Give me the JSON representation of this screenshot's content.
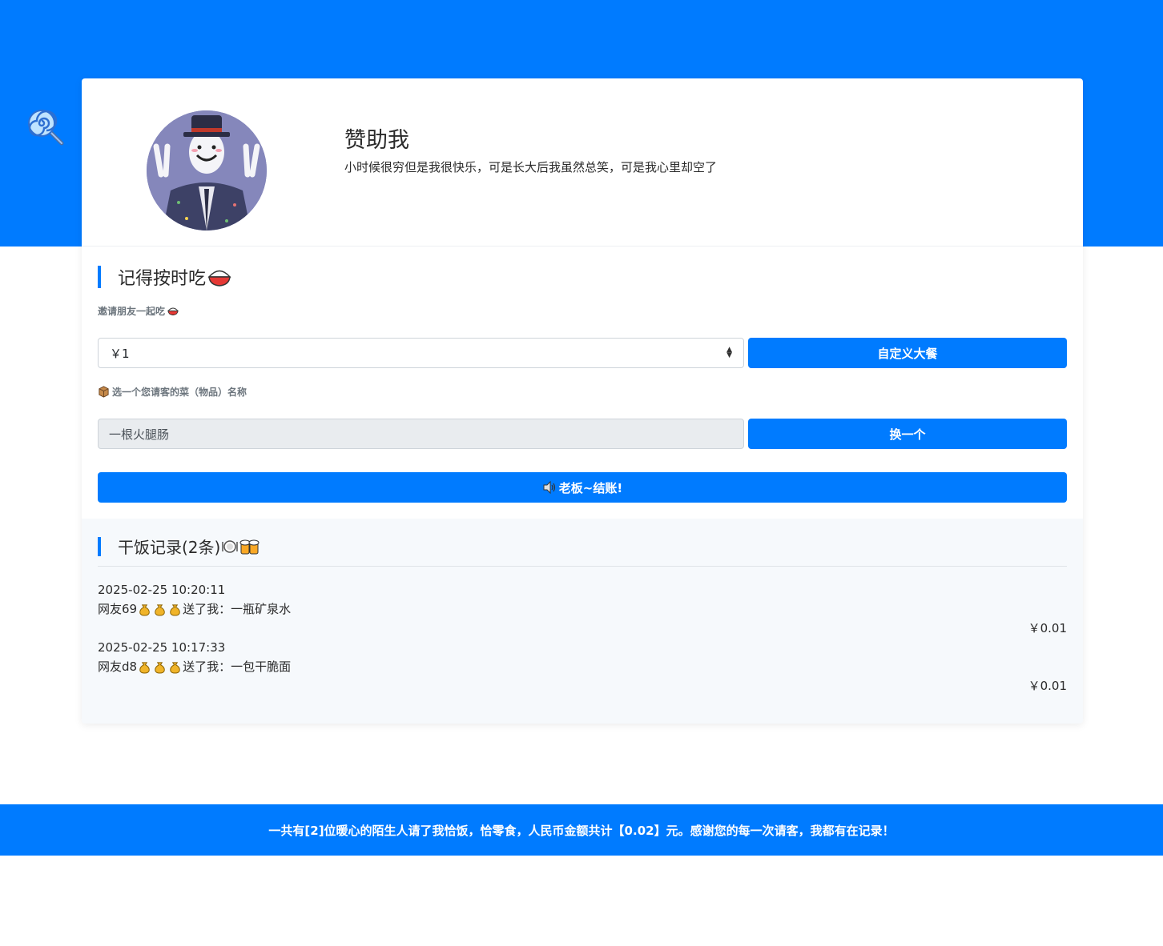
{
  "profile": {
    "title": "赞助我",
    "subtitle": "小时候很穷但是我很快乐，可是长大后我虽然总笑，可是我心里却空了"
  },
  "order": {
    "section_title": "记得按时吃",
    "invite_hint": "邀请朋友一起吃",
    "amount_select_value": "￥1",
    "custom_meal_button": "自定义大餐",
    "item_hint": "选一个您请客的菜（物品）名称",
    "item_value": "一根火腿肠",
    "change_button": "换一个",
    "checkout_button": "老板~结账!"
  },
  "records": {
    "section_title": "干饭记录(2条)",
    "items": [
      {
        "time": "2025-02-25 10:20:11",
        "user": "网友69",
        "text": "送了我：一瓶矿泉水",
        "amount": "￥0.01"
      },
      {
        "time": "2025-02-25 10:17:33",
        "user": "网友d8",
        "text": "送了我：一包干脆面",
        "amount": "￥0.01"
      }
    ]
  },
  "footer": {
    "text": "一共有[2]位暖心的陌生人请了我恰饭，恰零食，人民币金额共计【0.02】元。感谢您的每一次请客，我都有在记录！"
  },
  "colors": {
    "primary": "#007bff",
    "records_background": "#f6f9fc"
  },
  "icons": [
    "lollipop-icon",
    "rice-bowl-icon",
    "package-icon",
    "speaker-icon",
    "plate-icon",
    "beer-icon",
    "money-bag-icon"
  ]
}
